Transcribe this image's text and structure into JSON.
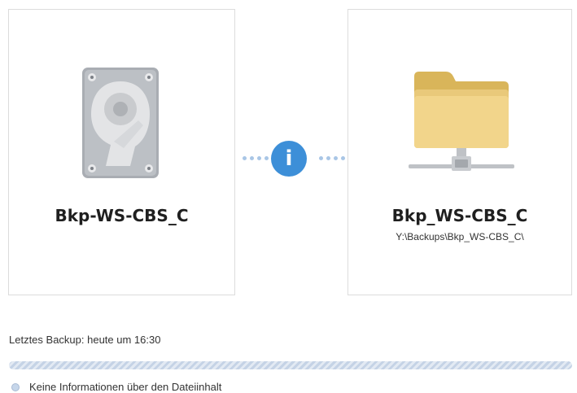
{
  "source": {
    "title": "Bkp-WS-CBS_C",
    "icon": "hard-drive-icon"
  },
  "destination": {
    "title": "Bkp_WS-CBS_C",
    "path": "Y:\\Backups\\Bkp_WS-CBS_C\\",
    "icon": "network-folder-icon"
  },
  "info_button": {
    "label": "i",
    "color": "#3d8fd8"
  },
  "status": {
    "last_backup": "Letztes Backup: heute um 16:30",
    "content_info": "Keine Informationen über den Dateiinhalt"
  }
}
